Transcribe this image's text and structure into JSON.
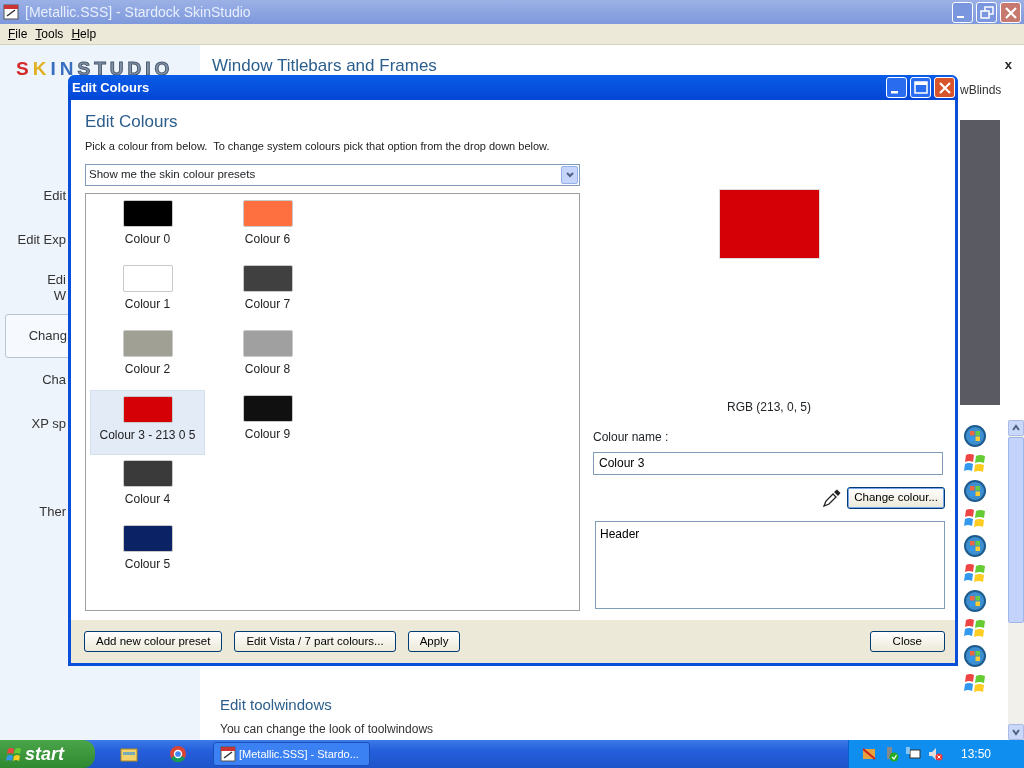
{
  "app_window": {
    "title": "[Metallic.SSS] - Stardock SkinStudio"
  },
  "menu": [
    {
      "label": "File"
    },
    {
      "label": "Tools"
    },
    {
      "label": "Help"
    }
  ],
  "logo": {
    "text": "SKINSTUDIO"
  },
  "sidebar": {
    "items": [
      {
        "lines": [
          "Edit"
        ],
        "selected": false
      },
      {
        "lines": [
          "Edit Exp"
        ],
        "selected": false
      },
      {
        "lines": [
          "Edi",
          "W"
        ],
        "selected": false
      },
      {
        "lines": [
          "Chang"
        ],
        "selected": true
      },
      {
        "lines": [
          "Cha"
        ],
        "selected": false
      },
      {
        "lines": [
          "XP sp"
        ],
        "selected": false
      },
      {
        "lines": [
          "Ther"
        ],
        "selected": false
      }
    ]
  },
  "content": {
    "heading": "Window Titlebars and Frames",
    "close": "x",
    "side_text": "wBlinds",
    "section": {
      "title": "Edit toolwindows",
      "description": "You can change the look of toolwindows"
    }
  },
  "dialog": {
    "title": "Edit Colours",
    "heading": "Edit Colours",
    "instruction": "Pick a colour from below.  To change system colours pick that option from the drop down below.",
    "dropdown": {
      "value": "Show me the skin colour presets"
    },
    "colours": [
      {
        "label": "Colour 0",
        "color": "#000000",
        "selected": false
      },
      {
        "label": "Colour 1",
        "color": "#ffffff",
        "selected": false
      },
      {
        "label": "Colour 2",
        "color": "#a0a095",
        "selected": false
      },
      {
        "label": "Colour 3 - 213 0 5",
        "color": "#d50005",
        "selected": true
      },
      {
        "label": "Colour 4",
        "color": "#3a3a3a",
        "selected": false
      },
      {
        "label": "Colour 5",
        "color": "#0b2365",
        "selected": false
      },
      {
        "label": "Colour 6",
        "color": "#ff7040",
        "selected": false
      },
      {
        "label": "Colour 7",
        "color": "#404040",
        "selected": false
      },
      {
        "label": "Colour 8",
        "color": "#a0a0a0",
        "selected": false
      },
      {
        "label": "Colour 9",
        "color": "#101010",
        "selected": false
      }
    ],
    "rgb_text": "RGB (213, 0, 5)",
    "name_label": "Colour name :",
    "name_field": {
      "value": "Colour 3"
    },
    "change_button": "Change colour...",
    "notes_field": {
      "value": "Header"
    },
    "buttons": [
      "Add new colour preset",
      "Edit Vista / 7 part colours...",
      "Apply"
    ],
    "close_button": "Close"
  },
  "taskbar": {
    "start": "start",
    "tasks": [
      {
        "label": "[Metallic.SSS] - Stardo...",
        "selected": false
      }
    ],
    "clock": "13:50"
  }
}
